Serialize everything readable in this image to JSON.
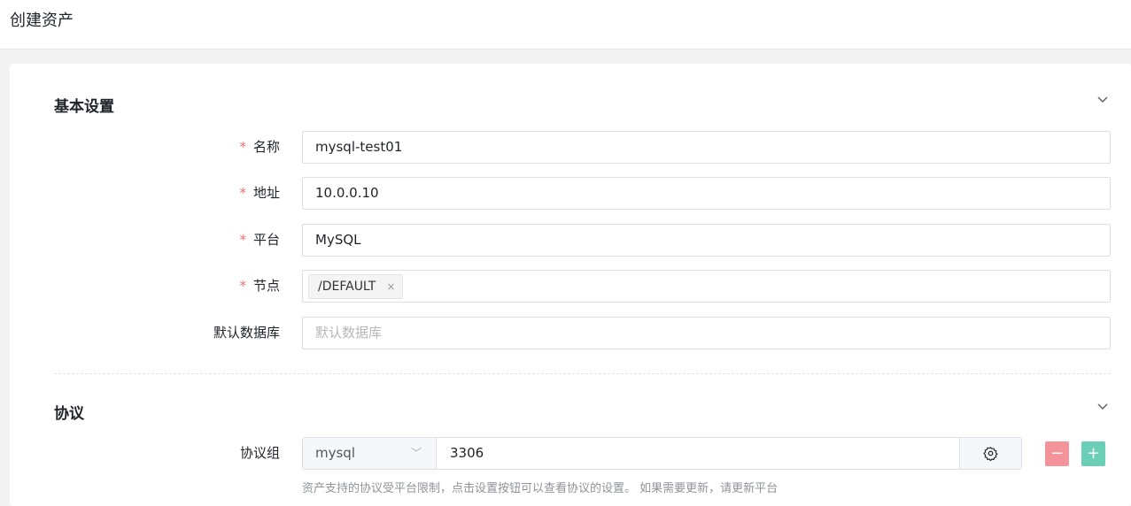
{
  "page": {
    "title": "创建资产"
  },
  "basic": {
    "title": "基本设置",
    "name": {
      "label": "名称",
      "value": "mysql-test01"
    },
    "address": {
      "label": "地址",
      "value": "10.0.0.10"
    },
    "platform": {
      "label": "平台",
      "value": "MySQL"
    },
    "node": {
      "label": "节点",
      "tag": "/DEFAULT",
      "remove": "×"
    },
    "db": {
      "label": "默认数据库",
      "placeholder": "默认数据库"
    },
    "required_mark": "*"
  },
  "protocol": {
    "title": "协议",
    "label": "协议组",
    "name": "mysql",
    "port": "3306",
    "minus": "−",
    "plus": "+",
    "help": "资产支持的协议受平台限制，点击设置按钮可以查看协议的设置。 如果需要更新，请更新平台"
  }
}
